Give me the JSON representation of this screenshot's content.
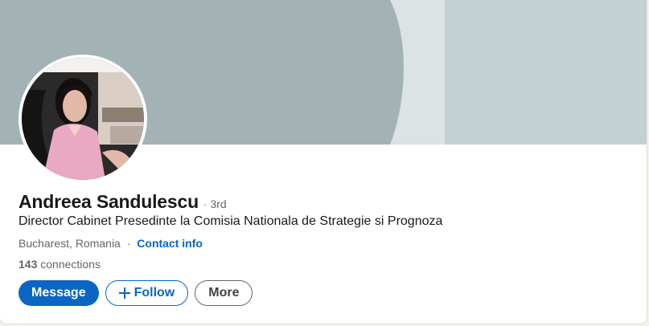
{
  "profile": {
    "name": "Andreea Sandulescu",
    "degree": "· 3rd",
    "headline": "Director Cabinet Presedinte la Comisia Nationala de Strategie si Prognoza",
    "location": "Bucharest, Romania",
    "separator": "·",
    "contact_info_label": "Contact info",
    "connections_count": "143",
    "connections_label": "connections"
  },
  "actions": {
    "message_label": "Message",
    "follow_label": "Follow",
    "more_label": "More"
  },
  "colors": {
    "accent": "#0a66c2",
    "banner_light": "#c3d0d4",
    "banner_dark": "#a3b2b5"
  },
  "icons": {
    "follow": "plus-icon"
  }
}
